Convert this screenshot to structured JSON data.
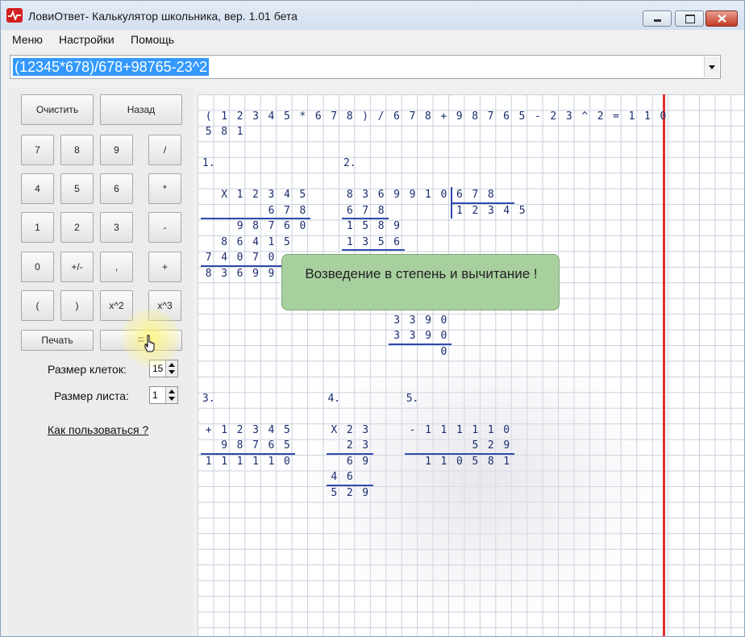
{
  "window": {
    "title": "ЛовиОтвет- Калькулятор школьника, вер.  1.01 бета",
    "controls": [
      "minimize-icon",
      "maximize-icon",
      "close-icon"
    ]
  },
  "menu": [
    "Меню",
    "Настройки",
    "Помощь"
  ],
  "expression": {
    "value": "(12345*678)/678+98765-23^2"
  },
  "keypad": {
    "clear": "Очистить",
    "back": "Назад",
    "keys": [
      [
        "7",
        "8",
        "9",
        "/"
      ],
      [
        "4",
        "5",
        "6",
        "*"
      ],
      [
        "1",
        "2",
        "3",
        "-"
      ],
      [
        "0",
        "+/-",
        ",",
        "+"
      ],
      [
        "(",
        ")",
        "x^2",
        "x^3"
      ]
    ],
    "print": "Печать",
    "equals": "="
  },
  "settings": {
    "cell_size_label": "Размер клеток:",
    "cell_size_value": "15",
    "sheet_size_label": "Размер листа:",
    "sheet_size_value": "1"
  },
  "help_link": "Как пользоваться ?",
  "tooltip": "Возведение в степень и вычитание !",
  "sheet": {
    "colors": {
      "ink": "#1b2c6e",
      "grid": "#c9d0dc",
      "margin": "#e03030"
    },
    "expression_row": [
      "(",
      "1",
      "2",
      "3",
      "4",
      "5",
      "*",
      "6",
      "7",
      "8",
      ")",
      "/",
      "6",
      "7",
      "8",
      "+",
      "9",
      "8",
      "7",
      "6",
      "5",
      "-",
      "2",
      "3",
      "^",
      "2",
      "=",
      "1",
      "1",
      "0"
    ],
    "result_row": [
      "5",
      "8",
      "1"
    ],
    "step_labels": [
      "1.",
      "2.",
      "3.",
      "4.",
      "5."
    ],
    "step1": {
      "rows": [
        [
          "X",
          "1",
          "2",
          "3",
          "4",
          "5"
        ],
        [
          "6",
          "7",
          "8"
        ],
        [
          "9",
          "8",
          "7",
          "6",
          "0"
        ],
        [
          "8",
          "6",
          "4",
          "1",
          "5"
        ],
        [
          "7",
          "4",
          "0",
          "7",
          "0"
        ],
        [
          "8",
          "3",
          "6",
          "9",
          "9"
        ]
      ]
    },
    "step2": {
      "dividend": [
        "8",
        "3",
        "6",
        "9",
        "9",
        "1",
        "0"
      ],
      "divisor": [
        "6",
        "7",
        "8"
      ],
      "quotient": [
        "1",
        "2",
        "3",
        "4",
        "5"
      ],
      "rows": [
        [
          "6",
          "7",
          "8"
        ],
        [
          "1",
          "5",
          "8",
          "9"
        ],
        [
          "1",
          "3",
          "5",
          "6"
        ],
        [
          "3",
          "3",
          "9",
          "0"
        ],
        [
          "3",
          "3",
          "9",
          "0"
        ],
        [
          "0"
        ]
      ]
    },
    "step3": {
      "rows": [
        [
          "+",
          "1",
          "2",
          "3",
          "4",
          "5"
        ],
        [
          "9",
          "8",
          "7",
          "6",
          "5"
        ],
        [
          "1",
          "1",
          "1",
          "1",
          "1",
          "0"
        ]
      ]
    },
    "step4": {
      "rows": [
        [
          "X",
          "2",
          "3"
        ],
        [
          "2",
          "3"
        ],
        [
          "6",
          "9"
        ],
        [
          "4",
          "6"
        ],
        [
          "5",
          "2",
          "9"
        ]
      ]
    },
    "step5": {
      "rows": [
        [
          "-",
          "1",
          "1",
          "1",
          "1",
          "1",
          "0"
        ],
        [
          "5",
          "2",
          "9"
        ],
        [
          "1",
          "1",
          "0",
          "5",
          "8",
          "1"
        ]
      ]
    }
  }
}
